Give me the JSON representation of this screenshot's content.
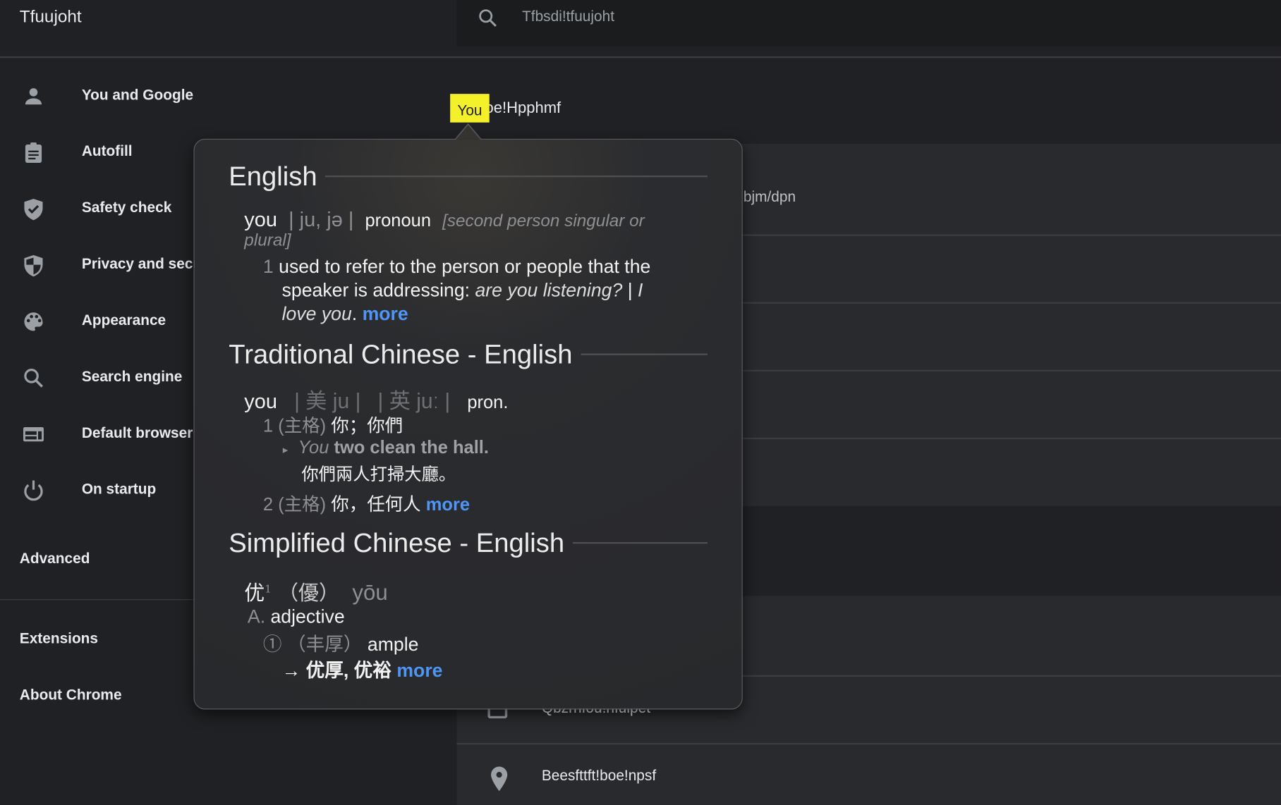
{
  "app": {
    "title": "Tfuujoht"
  },
  "search": {
    "placeholder": "Tfbsdi!tfuujoht"
  },
  "sidebar": {
    "items": [
      {
        "label": "You and Google",
        "icon": "person-icon"
      },
      {
        "label": "Autofill",
        "icon": "clipboard-icon"
      },
      {
        "label": "Safety check",
        "icon": "shield-check-icon"
      },
      {
        "label": "Privacy and secu",
        "icon": "shield-half-icon"
      },
      {
        "label": "Appearance",
        "icon": "palette-icon"
      },
      {
        "label": "Search engine",
        "icon": "search-icon"
      },
      {
        "label": "Default browser",
        "icon": "browser-icon"
      },
      {
        "label": "On startup",
        "icon": "power-icon"
      }
    ],
    "advanced": "Advanced",
    "extensions": "Extensions",
    "about": "About Chrome"
  },
  "main": {
    "section_highlight": "You",
    "section_rest": "boe!Hpphmf",
    "email_fragment": "bjm/dpn",
    "payment_fragment": "Qbzrnfou!nfuipet",
    "addresses": "Beesfttft!boe!npsf"
  },
  "highlight_color": "#f4f12a",
  "link_color": "#4e95f5",
  "popup": {
    "english": {
      "heading": "English",
      "word": "you",
      "pron": "| ju, jə |",
      "pos": "pronoun",
      "note1": "[second person singular or",
      "note2": "plural]",
      "num": "1",
      "def1": "used to refer to the person or people that the",
      "def2": "speaker is addressing:",
      "ex1": "are you listening?",
      "sep": "|",
      "ex2a": "I",
      "ex2b": "love you",
      "dot": ".",
      "more": "more"
    },
    "trad": {
      "heading": "Traditional Chinese - English",
      "word": "you",
      "pron_us": "| 美 ju |",
      "pron_uk": "| 英 juː |",
      "pos": "pron.",
      "s1_num": "1",
      "s1_tag": "(主格)",
      "s1_def": "你；你們",
      "ex_bullet": "▸",
      "ex_em": "You",
      "ex_rest": "two clean the hall.",
      "ex_zh": "你們兩人打掃大廳。",
      "s2_num": "2",
      "s2_tag": "(主格)",
      "s2_def": "你，任何人",
      "more": "more"
    },
    "simp": {
      "heading": "Simplified Chinese - English",
      "head_char": "优",
      "sup": "1",
      "trad_char": "（優）",
      "pinyin": "yōu",
      "pos_letter": "A.",
      "pos": "adjective",
      "sense_num": "①",
      "sense_tag": "（丰厚）",
      "sense": "ample",
      "arrow": "→",
      "related": "优厚, 优裕",
      "more": "more"
    }
  }
}
